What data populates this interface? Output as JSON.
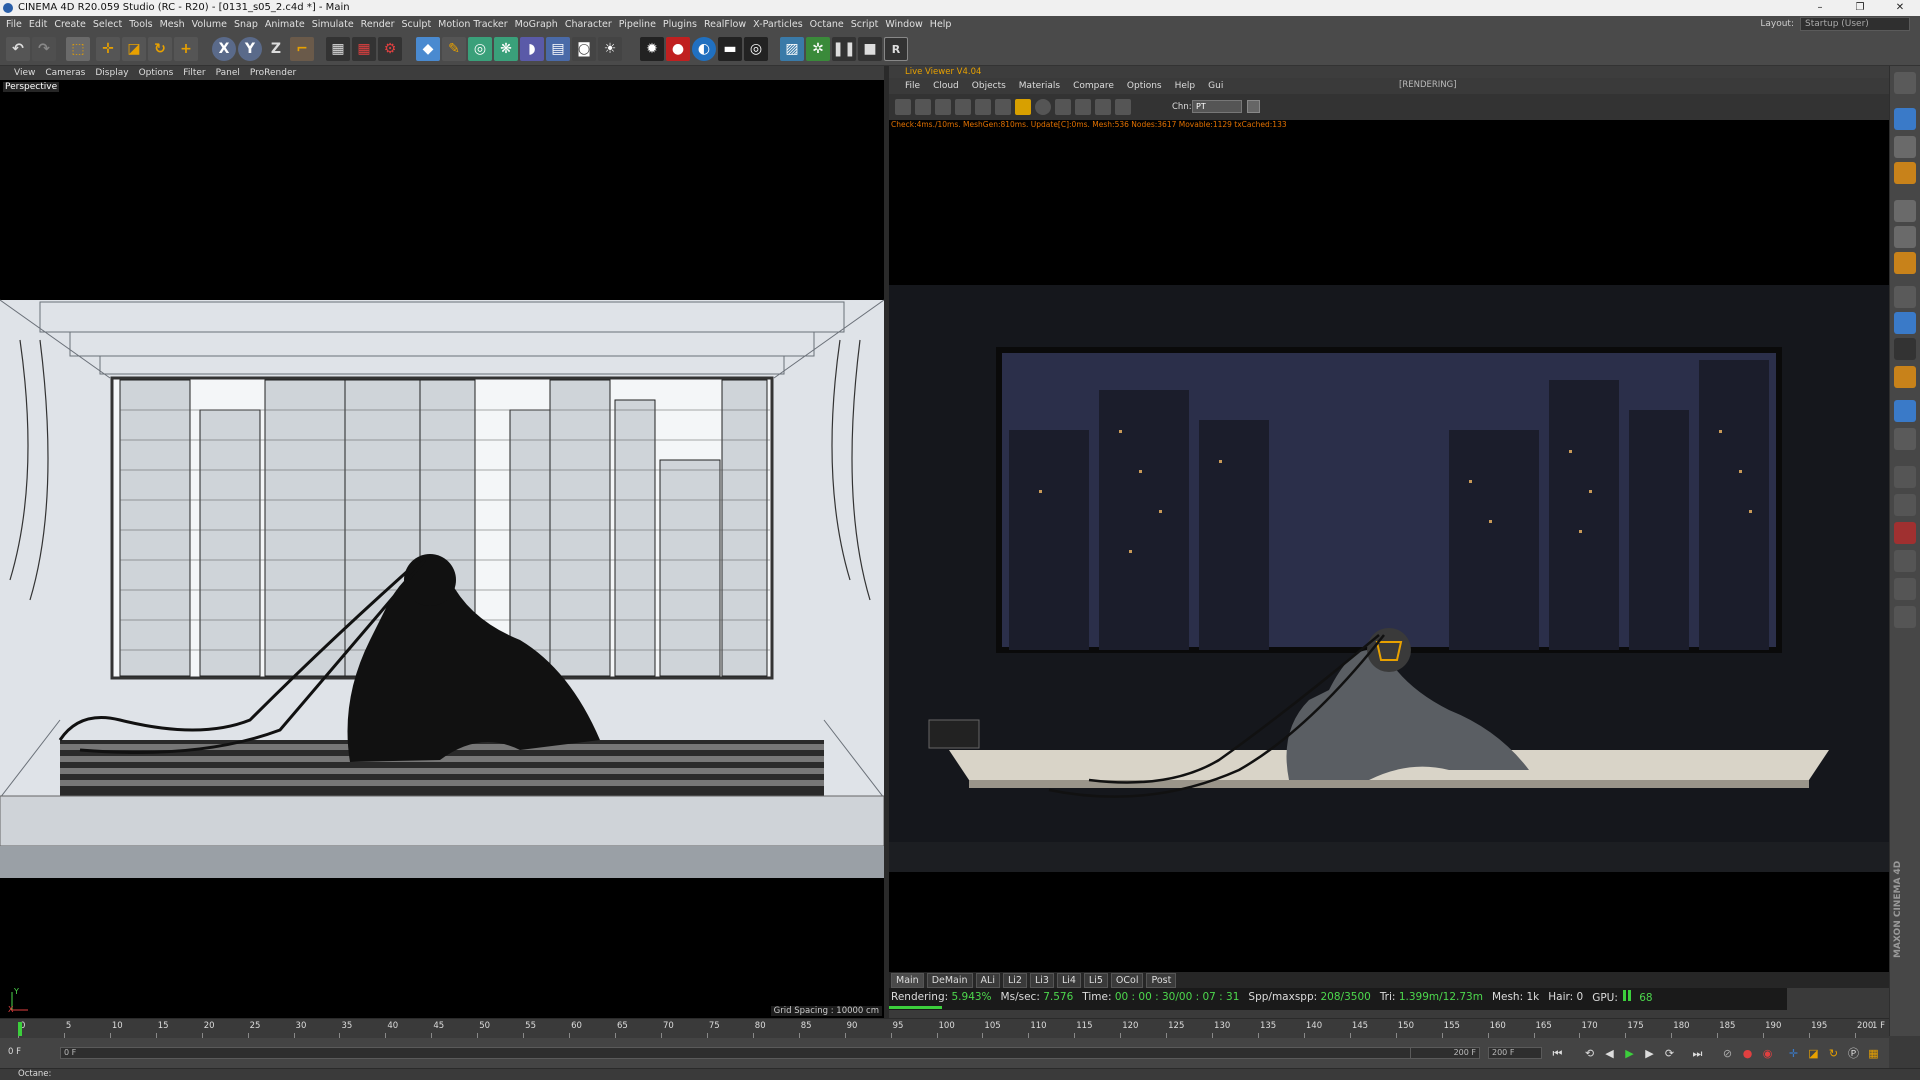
{
  "window": {
    "title": "CINEMA 4D R20.059 Studio (RC - R20) - [0131_s05_2.c4d *] - Main",
    "controls": [
      "–",
      "❐",
      "✕"
    ]
  },
  "menubar": {
    "items": [
      "File",
      "Edit",
      "Create",
      "Select",
      "Tools",
      "Mesh",
      "Volume",
      "Snap",
      "Animate",
      "Simulate",
      "Render",
      "Sculpt",
      "Motion Tracker",
      "MoGraph",
      "Character",
      "Pipeline",
      "Plugins",
      "RealFlow",
      "X-Particles",
      "Octane",
      "Script",
      "Window",
      "Help"
    ],
    "layout_label": "Layout:",
    "layout_value": "Startup (User)"
  },
  "toolbar": {
    "icons": [
      "undo-icon",
      "redo-icon",
      "live-selection-icon",
      "move-icon",
      "scale-icon",
      "rotate-icon",
      "recent-tool-icon",
      "x-axis-icon",
      "y-axis-icon",
      "z-axis-icon",
      "coordinate-system-icon",
      "render-view-icon",
      "render-picture-viewer-icon",
      "render-settings-icon",
      "cube-icon",
      "pen-icon",
      "subdivision-icon",
      "cloner-icon",
      "deformer-icon",
      "floor-icon",
      "camera-icon",
      "light-icon",
      "octane-settings-icon",
      "octane-record-icon",
      "octane-material-icon",
      "octane-object-icon",
      "octane-texture-icon",
      "octane-scatter-icon",
      "octane-gear-icon",
      "octane-pause-icon",
      "octane-stop-icon",
      "octane-reset-icon"
    ],
    "axis_labels": [
      "X",
      "Y",
      "Z"
    ],
    "extra_labels": [
      "R"
    ]
  },
  "viewport": {
    "menu": [
      "View",
      "Cameras",
      "Display",
      "Options",
      "Filter",
      "Panel",
      "ProRender"
    ],
    "name": "Perspective",
    "grid_spacing": "Grid Spacing : 10000 cm",
    "axis_y": "Y",
    "axis_x": "X"
  },
  "live_viewer": {
    "title": "Live Viewer V4.04",
    "menu": [
      "File",
      "Cloud",
      "Objects",
      "Materials",
      "Compare",
      "Options",
      "Help",
      "Gui"
    ],
    "state": "[RENDERING]",
    "channel_label": "Chn:",
    "channel_value": "PT",
    "stats_line": "Check:4ms./10ms. MeshGen:810ms. Update[C]:0ms. Mesh:536 Nodes:3617 Movable:1129 txCached:133",
    "tabs": [
      "Main",
      "DeMain",
      "ALi",
      "Li2",
      "Li3",
      "Li4",
      "Li5",
      "OCol",
      "Post"
    ],
    "active_tab": "Main",
    "status": {
      "rendering_label": "Rendering:",
      "rendering_value": "5.943%",
      "mssec_label": "Ms/sec:",
      "mssec_value": "7.576",
      "time_label": "Time:",
      "time_value": "00 : 00 : 30/00 : 07 : 31",
      "spp_label": "Spp/maxspp:",
      "spp_value": "208/3500",
      "tri_label": "Tri:",
      "tri_value": "1.399m/12.73m",
      "mesh_label": "Mesh:",
      "mesh_value": "1k",
      "hair_label": "Hair:",
      "hair_value": "0",
      "gpu_label": "GPU:",
      "gpu_value": "68"
    },
    "progress": 0.05943
  },
  "timeline": {
    "ticks": [
      "0",
      "5",
      "10",
      "15",
      "20",
      "25",
      "30",
      "35",
      "40",
      "45",
      "50",
      "55",
      "60",
      "65",
      "70",
      "75",
      "80",
      "85",
      "90",
      "95",
      "100",
      "105",
      "110",
      "115",
      "120",
      "125",
      "130",
      "135",
      "140",
      "145",
      "150",
      "155",
      "160",
      "165",
      "170",
      "175",
      "180",
      "185",
      "190",
      "195",
      "200"
    ],
    "current_frame": "0 F",
    "end_label": "1 F",
    "start_field": "0 F",
    "min_field": "0 F",
    "max_field": "200 F",
    "end_field": "200 F"
  },
  "status_line": "Octane:",
  "brand": "MAXON CINEMA 4D",
  "colors": {
    "accent": "#e8a100",
    "green": "#3ccf3c",
    "bg": "#3a3a3a"
  }
}
